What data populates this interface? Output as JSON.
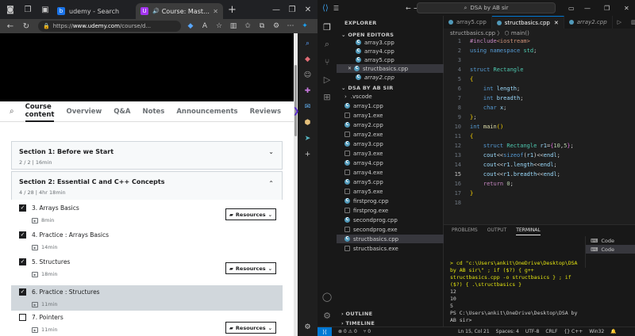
{
  "browser": {
    "tabs": [
      {
        "label": "udemy - Search",
        "icon": "bing-icon",
        "active": false
      },
      {
        "label": "Course: Mastering Da",
        "icon": "udemy-icon",
        "active": true
      }
    ],
    "url_prefix": "https://",
    "url_host": "www.udemy.com",
    "url_path": "/course/d...",
    "course_tabs": [
      "Course content",
      "Overview",
      "Q&A",
      "Notes",
      "Announcements",
      "Reviews"
    ],
    "sections": [
      {
        "title": "Section 1: Before we Start",
        "sub": "2 / 2 | 16min",
        "chevron": "⌄"
      },
      {
        "title": "Section 2: Essential C and C++ Concepts",
        "sub": "4 / 28 | 4hr 18min",
        "chevron": "⌃"
      }
    ],
    "lectures": [
      {
        "title": "3. Arrays Basics",
        "dur": "8min",
        "checked": true,
        "resources": true
      },
      {
        "title": "4. Practice : Arrays Basics",
        "dur": "14min",
        "checked": true,
        "resources": false
      },
      {
        "title": "5. Structures",
        "dur": "18min",
        "checked": true,
        "resources": true
      },
      {
        "title": "6. Practice : Structures",
        "dur": "11min",
        "checked": true,
        "resources": false,
        "current": true
      },
      {
        "title": "7. Pointers",
        "dur": "11min",
        "checked": false,
        "resources": true
      }
    ],
    "resources_label": "Resources"
  },
  "vscode": {
    "search": "DSA by AB sir",
    "explorer_title": "EXPLORER",
    "open_editors_title": "OPEN EDITORS",
    "open_editors": [
      "array3.cpp",
      "array4.cpp",
      "array5.cpp",
      "structbasics.cpp",
      "array2.cpp"
    ],
    "folder_title": "DSA BY AB SIR",
    "files": [
      ".vscode",
      "array1.cpp",
      "array1.exe",
      "array2.cpp",
      "array2.exe",
      "array3.cpp",
      "array3.exe",
      "array4.cpp",
      "array4.exe",
      "array5.cpp",
      "array5.exe",
      "firstprog.cpp",
      "firstprog.exe",
      "secondprog.cpp",
      "secondprog.exe",
      "structbasics.cpp",
      "structbasics.exe"
    ],
    "outline": "OUTLINE",
    "timeline": "TIMELINE",
    "editor_tabs": [
      "array5.cpp",
      "structbasics.cpp",
      "array2.cpp"
    ],
    "breadcrumb": "structbasics.cpp 〉 ⬡ main()",
    "panel_tabs": [
      "PROBLEMS",
      "OUTPUT",
      "TERMINAL"
    ],
    "terminal_cmd": "> cd \"c:\\Users\\ankit\\OneDrive\\Desktop\\DSA by AB sir\\\" ; if ($?) { g++ structbasics.cpp -o structbasics } ; if ($?) { .\\structbasics }",
    "terminal_out": [
      "12",
      "10",
      "5"
    ],
    "terminal_prompt": "PS C:\\Users\\ankit\\OneDrive\\Desktop\\DSA by AB sir>",
    "terminal_list": [
      "Code",
      "Code"
    ],
    "status": {
      "errors": "⊗ 0 ⚠ 0",
      "ports": "⑂ 0",
      "pos": "Ln 15, Col 21",
      "spaces": "Spaces: 4",
      "enc": "UTF-8",
      "eol": "CRLF",
      "lang": "{} C++",
      "plat": "Win32"
    }
  }
}
